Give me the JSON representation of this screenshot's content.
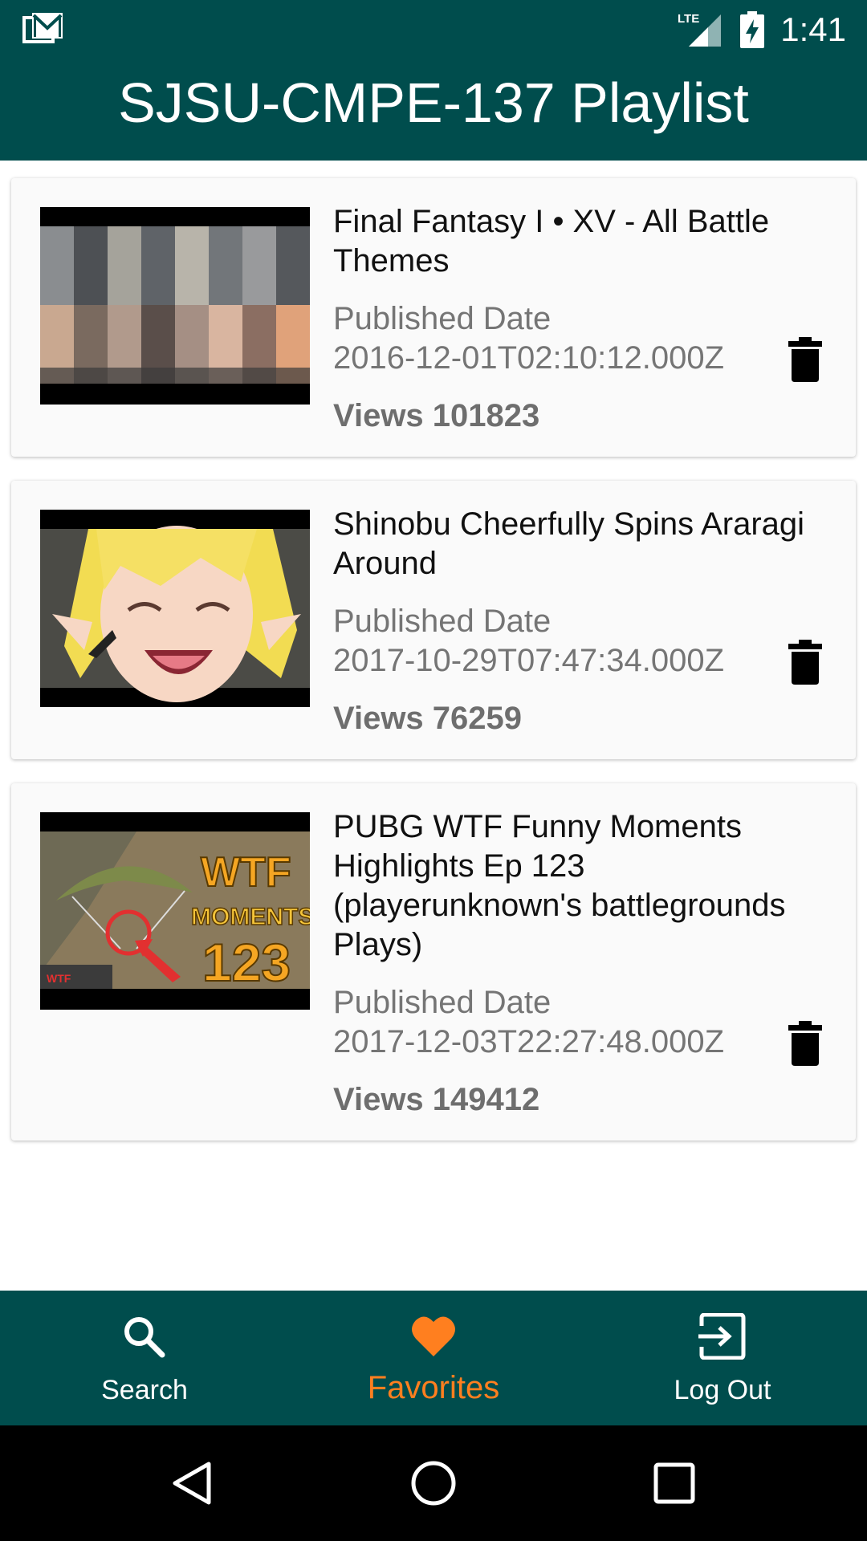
{
  "status_bar": {
    "time": "1:41",
    "network": "LTE",
    "icons": [
      "gmail-icon",
      "lte-signal-icon",
      "battery-charging-icon"
    ]
  },
  "app_bar": {
    "title": "SJSU-CMPE-137 Playlist"
  },
  "videos": [
    {
      "title": "Final Fantasy I • XV - All Battle Themes",
      "published_label": "Published Date",
      "published_date": "2016-12-01T02:10:12.000Z",
      "views": "Views 101823",
      "delete_icon": "trash-icon"
    },
    {
      "title": "Shinobu Cheerfully Spins Araragi Around",
      "published_label": "Published Date",
      "published_date": "2017-10-29T07:47:34.000Z",
      "views": "Views 76259",
      "delete_icon": "trash-icon"
    },
    {
      "title": "PUBG WTF Funny Moments Highlights Ep 123 (playerunknown's battlegrounds Plays)",
      "published_label": "Published Date",
      "published_date": "2017-12-03T22:27:48.000Z",
      "views": "Views 149412",
      "delete_icon": "trash-icon",
      "thumbnail_text": {
        "line1": "WTF",
        "line2": "MOMENTS",
        "line3": "123"
      }
    }
  ],
  "bottom_nav": {
    "items": [
      {
        "label": "Search",
        "icon": "search-icon",
        "active": false
      },
      {
        "label": "Favorites",
        "icon": "heart-icon",
        "active": true
      },
      {
        "label": "Log Out",
        "icon": "logout-icon",
        "active": false
      }
    ]
  },
  "system_nav": {
    "icons": [
      "back-icon",
      "home-icon",
      "recents-icon"
    ]
  },
  "colors": {
    "primary": "#004d4d",
    "accent": "#ff7f1f",
    "card_background": "#fafafa"
  }
}
